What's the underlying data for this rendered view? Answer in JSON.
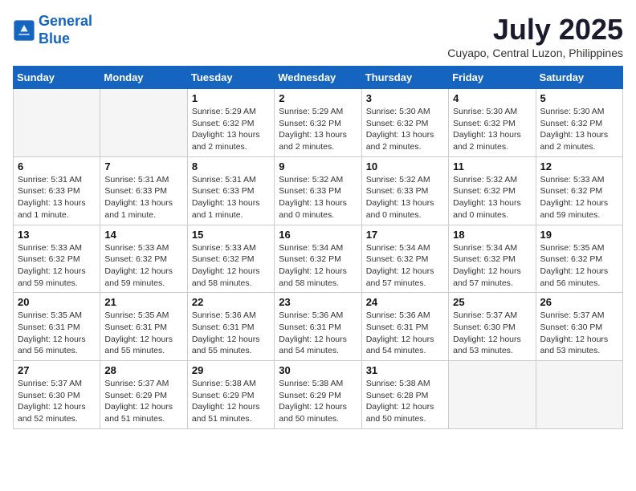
{
  "header": {
    "logo_line1": "General",
    "logo_line2": "Blue",
    "month_year": "July 2025",
    "location": "Cuyapo, Central Luzon, Philippines"
  },
  "weekdays": [
    "Sunday",
    "Monday",
    "Tuesday",
    "Wednesday",
    "Thursday",
    "Friday",
    "Saturday"
  ],
  "weeks": [
    [
      {
        "day": "",
        "info": ""
      },
      {
        "day": "",
        "info": ""
      },
      {
        "day": "1",
        "info": "Sunrise: 5:29 AM\nSunset: 6:32 PM\nDaylight: 13 hours and 2 minutes."
      },
      {
        "day": "2",
        "info": "Sunrise: 5:29 AM\nSunset: 6:32 PM\nDaylight: 13 hours and 2 minutes."
      },
      {
        "day": "3",
        "info": "Sunrise: 5:30 AM\nSunset: 6:32 PM\nDaylight: 13 hours and 2 minutes."
      },
      {
        "day": "4",
        "info": "Sunrise: 5:30 AM\nSunset: 6:32 PM\nDaylight: 13 hours and 2 minutes."
      },
      {
        "day": "5",
        "info": "Sunrise: 5:30 AM\nSunset: 6:32 PM\nDaylight: 13 hours and 2 minutes."
      }
    ],
    [
      {
        "day": "6",
        "info": "Sunrise: 5:31 AM\nSunset: 6:33 PM\nDaylight: 13 hours and 1 minute."
      },
      {
        "day": "7",
        "info": "Sunrise: 5:31 AM\nSunset: 6:33 PM\nDaylight: 13 hours and 1 minute."
      },
      {
        "day": "8",
        "info": "Sunrise: 5:31 AM\nSunset: 6:33 PM\nDaylight: 13 hours and 1 minute."
      },
      {
        "day": "9",
        "info": "Sunrise: 5:32 AM\nSunset: 6:33 PM\nDaylight: 13 hours and 0 minutes."
      },
      {
        "day": "10",
        "info": "Sunrise: 5:32 AM\nSunset: 6:33 PM\nDaylight: 13 hours and 0 minutes."
      },
      {
        "day": "11",
        "info": "Sunrise: 5:32 AM\nSunset: 6:32 PM\nDaylight: 13 hours and 0 minutes."
      },
      {
        "day": "12",
        "info": "Sunrise: 5:33 AM\nSunset: 6:32 PM\nDaylight: 12 hours and 59 minutes."
      }
    ],
    [
      {
        "day": "13",
        "info": "Sunrise: 5:33 AM\nSunset: 6:32 PM\nDaylight: 12 hours and 59 minutes."
      },
      {
        "day": "14",
        "info": "Sunrise: 5:33 AM\nSunset: 6:32 PM\nDaylight: 12 hours and 59 minutes."
      },
      {
        "day": "15",
        "info": "Sunrise: 5:33 AM\nSunset: 6:32 PM\nDaylight: 12 hours and 58 minutes."
      },
      {
        "day": "16",
        "info": "Sunrise: 5:34 AM\nSunset: 6:32 PM\nDaylight: 12 hours and 58 minutes."
      },
      {
        "day": "17",
        "info": "Sunrise: 5:34 AM\nSunset: 6:32 PM\nDaylight: 12 hours and 57 minutes."
      },
      {
        "day": "18",
        "info": "Sunrise: 5:34 AM\nSunset: 6:32 PM\nDaylight: 12 hours and 57 minutes."
      },
      {
        "day": "19",
        "info": "Sunrise: 5:35 AM\nSunset: 6:32 PM\nDaylight: 12 hours and 56 minutes."
      }
    ],
    [
      {
        "day": "20",
        "info": "Sunrise: 5:35 AM\nSunset: 6:31 PM\nDaylight: 12 hours and 56 minutes."
      },
      {
        "day": "21",
        "info": "Sunrise: 5:35 AM\nSunset: 6:31 PM\nDaylight: 12 hours and 55 minutes."
      },
      {
        "day": "22",
        "info": "Sunrise: 5:36 AM\nSunset: 6:31 PM\nDaylight: 12 hours and 55 minutes."
      },
      {
        "day": "23",
        "info": "Sunrise: 5:36 AM\nSunset: 6:31 PM\nDaylight: 12 hours and 54 minutes."
      },
      {
        "day": "24",
        "info": "Sunrise: 5:36 AM\nSunset: 6:31 PM\nDaylight: 12 hours and 54 minutes."
      },
      {
        "day": "25",
        "info": "Sunrise: 5:37 AM\nSunset: 6:30 PM\nDaylight: 12 hours and 53 minutes."
      },
      {
        "day": "26",
        "info": "Sunrise: 5:37 AM\nSunset: 6:30 PM\nDaylight: 12 hours and 53 minutes."
      }
    ],
    [
      {
        "day": "27",
        "info": "Sunrise: 5:37 AM\nSunset: 6:30 PM\nDaylight: 12 hours and 52 minutes."
      },
      {
        "day": "28",
        "info": "Sunrise: 5:37 AM\nSunset: 6:29 PM\nDaylight: 12 hours and 51 minutes."
      },
      {
        "day": "29",
        "info": "Sunrise: 5:38 AM\nSunset: 6:29 PM\nDaylight: 12 hours and 51 minutes."
      },
      {
        "day": "30",
        "info": "Sunrise: 5:38 AM\nSunset: 6:29 PM\nDaylight: 12 hours and 50 minutes."
      },
      {
        "day": "31",
        "info": "Sunrise: 5:38 AM\nSunset: 6:28 PM\nDaylight: 12 hours and 50 minutes."
      },
      {
        "day": "",
        "info": ""
      },
      {
        "day": "",
        "info": ""
      }
    ]
  ]
}
